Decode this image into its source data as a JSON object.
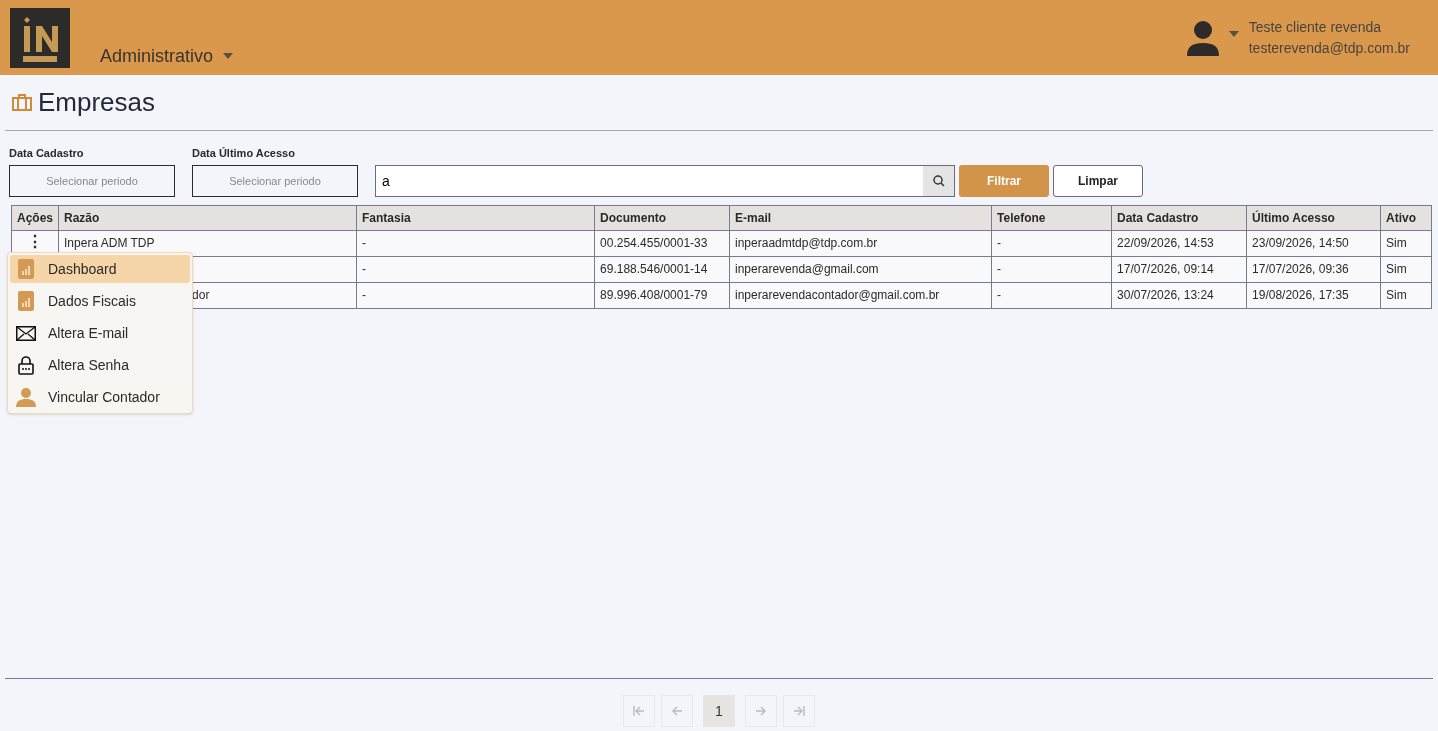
{
  "header": {
    "module": "Administrativo",
    "user_name": "Teste cliente revenda",
    "user_email": "testerevenda@tdp.com.br"
  },
  "page_title": "Empresas",
  "filters": [
    {
      "label": "Data Cadastro",
      "placeholder": "Selecionar periodo"
    },
    {
      "label": "Data Último Acesso",
      "placeholder": "Selecionar periodo"
    }
  ],
  "search": {
    "value": "a"
  },
  "buttons": {
    "filter": "Filtrar",
    "clear": "Limpar"
  },
  "table": {
    "columns": [
      "Ações",
      "Razão",
      "Fantasia",
      "Documento",
      "E-mail",
      "Telefone",
      "Data Cadastro",
      "Último Acesso",
      "Ativo"
    ],
    "rows": [
      {
        "cells": [
          "⋮",
          "Inpera ADM TDP",
          "-",
          "00.254.455/0001-33",
          "inperaadmtdp@tdp.com.br",
          "-",
          "22/09/2026, 14:53",
          "23/09/2026, 14:50",
          "Sim"
        ]
      },
      {
        "cells": [
          "",
          "",
          "-",
          "69.188.546/0001-14",
          "inperarevenda@gmail.com",
          "-",
          "17/07/2026, 09:14",
          "17/07/2026, 09:36",
          "Sim"
        ]
      },
      {
        "cells": [
          "",
          "dor",
          "-",
          "89.996.408/0001-79",
          "inperarevendacontador@gmail.com.br",
          "-",
          "30/07/2026, 13:24",
          "19/08/2026, 17:35",
          "Sim"
        ]
      }
    ]
  },
  "action_menu": [
    {
      "kind": "chart",
      "label": "Dashboard",
      "selected": true
    },
    {
      "kind": "chart",
      "label": "Dados Fiscais",
      "selected": false
    },
    {
      "kind": "mail",
      "label": "Altera E-mail",
      "selected": false
    },
    {
      "kind": "lock",
      "label": "Altera Senha",
      "selected": false
    },
    {
      "kind": "person",
      "label": "Vincular Contador",
      "selected": false
    }
  ],
  "pagination": {
    "current": "1"
  }
}
